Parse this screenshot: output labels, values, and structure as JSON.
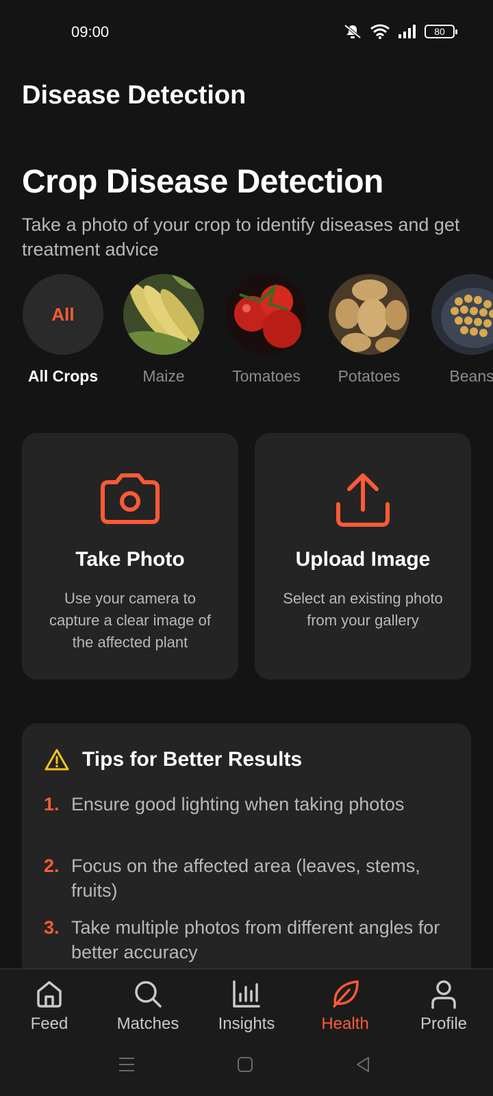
{
  "status_bar": {
    "time": "09:00",
    "battery": "80"
  },
  "app_title": "Disease Detection",
  "hero": {
    "title": "Crop Disease Detection",
    "subtitle": "Take a photo of your crop to identify diseases and get treatment advice"
  },
  "crops": [
    {
      "label": "All Crops",
      "badge": "All",
      "active": true
    },
    {
      "label": "Maize",
      "active": false
    },
    {
      "label": "Tomatoes",
      "active": false
    },
    {
      "label": "Potatoes",
      "active": false
    },
    {
      "label": "Beans",
      "active": false
    }
  ],
  "actions": {
    "take_photo": {
      "title": "Take Photo",
      "desc": "Use your camera to capture a clear image of the affected plant",
      "icon": "camera-icon"
    },
    "upload_image": {
      "title": "Upload Image",
      "desc": "Select an existing photo from your gallery",
      "icon": "upload-icon"
    }
  },
  "tips": {
    "title": "Tips for Better Results",
    "items": [
      {
        "num": "1.",
        "text": "Ensure good lighting when taking photos"
      },
      {
        "num": "2.",
        "text": "Focus on the affected area (leaves, stems, fruits)"
      },
      {
        "num": "3.",
        "text": "Take multiple photos from different angles for better accuracy"
      }
    ]
  },
  "nav": [
    {
      "label": "Feed",
      "icon": "home-icon"
    },
    {
      "label": "Matches",
      "icon": "search-icon"
    },
    {
      "label": "Insights",
      "icon": "bar-chart-icon"
    },
    {
      "label": "Health",
      "icon": "leaf-icon",
      "active": true
    },
    {
      "label": "Profile",
      "icon": "user-icon"
    }
  ],
  "colors": {
    "accent": "#ff5a36",
    "background": "#141414",
    "card": "#242424",
    "warning": "#f5c518"
  }
}
